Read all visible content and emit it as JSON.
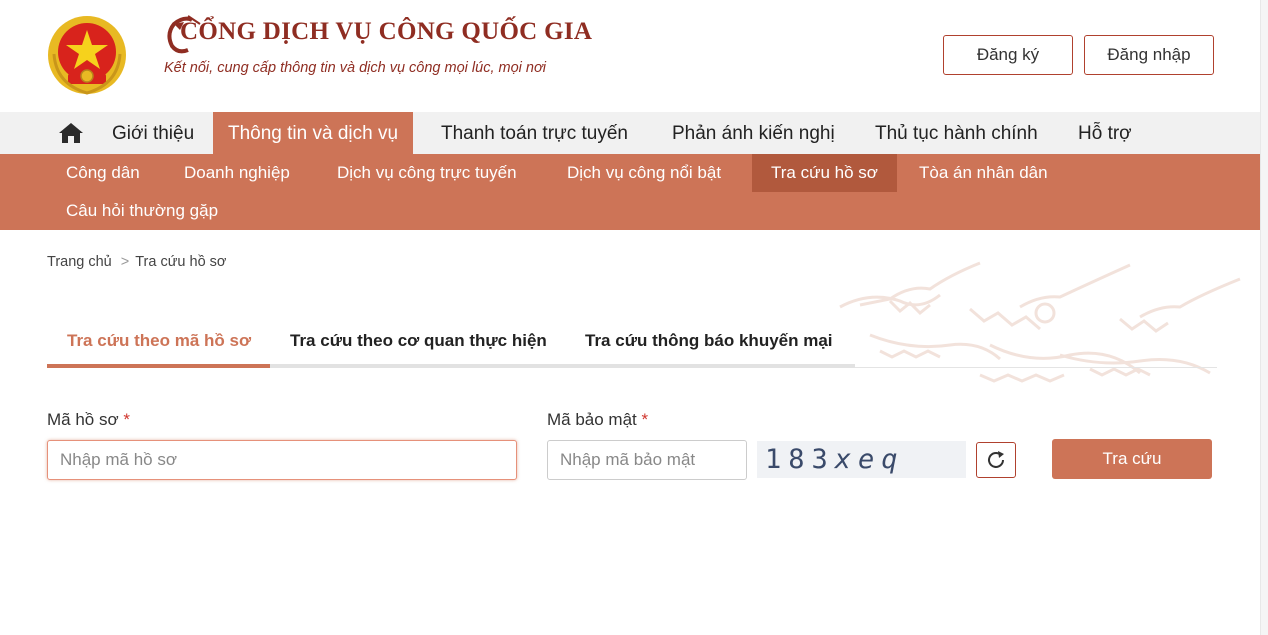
{
  "header": {
    "brand_title": "CỔNG DỊCH VỤ CÔNG QUỐC GIA",
    "brand_subtitle": "Kết nối, cung cấp thông tin và dịch vụ công mọi lúc, mọi nơi",
    "register_label": "Đăng ký",
    "login_label": "Đăng nhập"
  },
  "main_nav": {
    "items": [
      {
        "label": "Giới thiệu"
      },
      {
        "label": "Thông tin và dịch vụ",
        "active": true
      },
      {
        "label": "Thanh toán trực tuyến"
      },
      {
        "label": "Phản ánh kiến nghị"
      },
      {
        "label": "Thủ tục hành chính"
      },
      {
        "label": "Hỗ trợ"
      }
    ]
  },
  "sub_nav": {
    "items": [
      {
        "label": "Công dân"
      },
      {
        "label": "Doanh nghiệp"
      },
      {
        "label": "Dịch vụ công trực tuyến"
      },
      {
        "label": "Dịch vụ công nổi bật"
      },
      {
        "label": "Tra cứu hồ sơ",
        "active": true
      },
      {
        "label": "Tòa án nhân dân"
      },
      {
        "label": "Câu hỏi thường gặp"
      }
    ]
  },
  "breadcrumb": {
    "home": "Trang chủ",
    "separator": ">",
    "current": "Tra cứu hồ sơ"
  },
  "tabs": [
    {
      "label": "Tra cứu theo mã hồ sơ",
      "active": true
    },
    {
      "label": "Tra cứu theo cơ quan thực hiện"
    },
    {
      "label": "Tra cứu thông báo khuyến mại"
    }
  ],
  "form": {
    "dossier_label": "Mã hồ sơ",
    "dossier_placeholder": "Nhập mã hồ sơ",
    "security_label": "Mã bảo mật",
    "security_placeholder": "Nhập mã bảo mật",
    "required_mark": "*",
    "captcha_digits": "183",
    "captcha_letters": "xeq",
    "submit_label": "Tra cứu"
  },
  "colors": {
    "primary": "#cd7457",
    "primary_dark": "#b1593d",
    "brand_red": "#8f2d22",
    "nav_bg": "#f1f1f1"
  },
  "icons": [
    "national-emblem-icon",
    "crane-logo-icon",
    "home-icon",
    "refresh-icon",
    "decorative-cranes"
  ]
}
